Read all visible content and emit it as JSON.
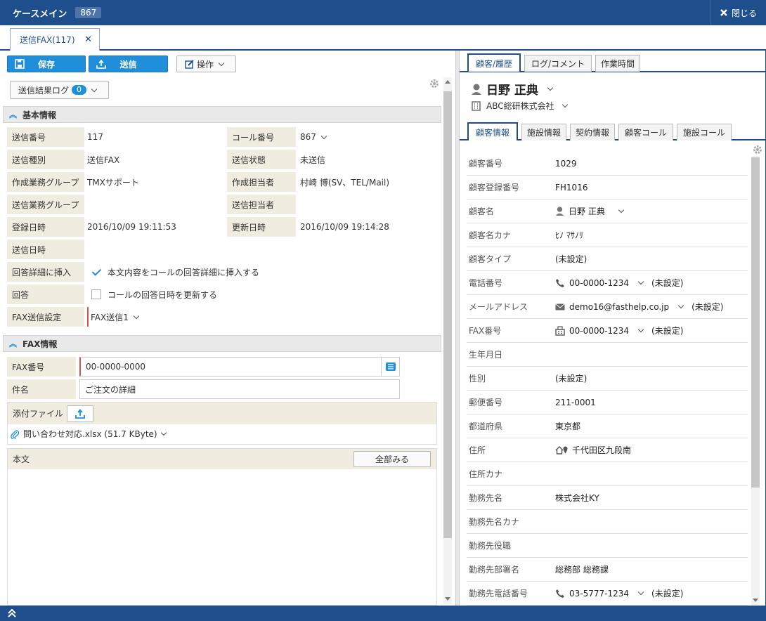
{
  "window": {
    "title": "ケースメイン",
    "case_id": "867",
    "close_label": "閉じる"
  },
  "doc_tab": {
    "label": "送信FAX(117)"
  },
  "toolbar": {
    "save_label": "保存",
    "send_label": "送信",
    "operation_label": "操作",
    "log_label": "送信結果ログ",
    "log_count": "0"
  },
  "basic": {
    "section_title": "基本情報",
    "send_no_label": "送信番号",
    "send_no": "117",
    "call_no_label": "コール番号",
    "call_no": "867",
    "send_type_label": "送信種別",
    "send_type": "送信FAX",
    "send_status_label": "送信状態",
    "send_status": "未送信",
    "create_group_label": "作成業務グループ",
    "create_group": "TMXサポート",
    "create_owner_label": "作成担当者",
    "create_owner": "村崎 博(SV、TEL/Mail)",
    "send_group_label": "送信業務グループ",
    "send_group": "",
    "send_owner_label": "送信担当者",
    "send_owner": "",
    "registered_label": "登録日時",
    "registered": "2016/10/09 19:11:53",
    "updated_label": "更新日時",
    "updated": "2016/10/09 19:14:28",
    "sent_at_label": "送信日時",
    "sent_at": "",
    "insert_label": "回答詳細に挿入",
    "insert_text": "本文内容をコールの回答詳細に挿入する",
    "insert_checked": true,
    "answer_label": "回答",
    "answer_text": "コールの回答日時を更新する",
    "answer_checked": false,
    "fax_setting_label": "FAX送信設定",
    "fax_setting": "FAX送信1"
  },
  "fax": {
    "section_title": "FAX情報",
    "number_label": "FAX番号",
    "number": "00-0000-0000",
    "subject_label": "件名",
    "subject": "ご注文の詳細",
    "attach_label": "添付ファイル",
    "attach_file": "問い合わせ対応.xlsx (51.7 KByte)",
    "body_label": "本文",
    "show_all_label": "全部みる"
  },
  "right_tabs": [
    "顧客/履歴",
    "ログ/コメント",
    "作業時間"
  ],
  "customer_header": {
    "name": "日野 正典",
    "company": "ABC総研株式会社"
  },
  "customer_tabs": [
    "顧客情報",
    "施設情報",
    "契約情報",
    "顧客コール",
    "施設コール"
  ],
  "customer_rows": [
    {
      "label": "顧客番号",
      "value": "1029"
    },
    {
      "label": "顧客登録番号",
      "value": "FH1016"
    },
    {
      "label": "顧客名",
      "value": "日野 正典"
    },
    {
      "label": "顧客名カナ",
      "value": "ﾋﾉ ﾏｻﾉﾘ"
    },
    {
      "label": "顧客タイプ",
      "value": "(未設定)"
    },
    {
      "label": "電話番号",
      "value": "00-0000-1234",
      "extra": "(未設定)"
    },
    {
      "label": "メールアドレス",
      "value": "demo16@fasthelp.co.jp",
      "extra": "(未設定)"
    },
    {
      "label": "FAX番号",
      "value": "00-0000-1234",
      "extra": "(未設定)"
    },
    {
      "label": "生年月日",
      "value": ""
    },
    {
      "label": "性別",
      "value": "(未設定)"
    },
    {
      "label": "郵便番号",
      "value": "211-0001"
    },
    {
      "label": "都道府県",
      "value": "東京都"
    },
    {
      "label": "住所",
      "value": "千代田区九段南"
    },
    {
      "label": "住所カナ",
      "value": ""
    },
    {
      "label": "勤務先名",
      "value": "株式会社KY"
    },
    {
      "label": "勤務先名カナ",
      "value": ""
    },
    {
      "label": "勤務先役職",
      "value": ""
    },
    {
      "label": "勤務先部署名",
      "value": "総務部 総務課"
    },
    {
      "label": "勤務先電話番号",
      "value": "03-5777-1234",
      "extra": "(未設定)"
    }
  ],
  "colors": {
    "primary": "#1f4e8c",
    "accent": "#1f8fdc",
    "label_bg": "#f0ece0"
  }
}
